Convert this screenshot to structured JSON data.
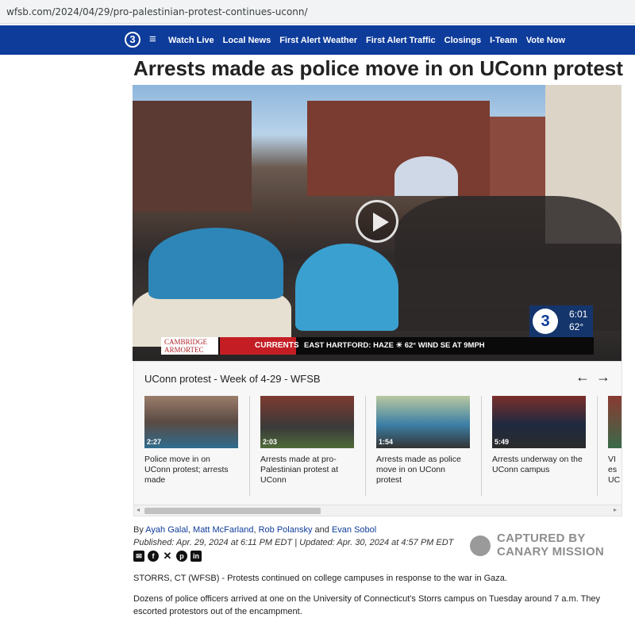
{
  "browser": {
    "url": "wfsb.com/2024/04/29/pro-palestinian-protest-continues-uconn/"
  },
  "nav": {
    "logo": "3",
    "menu_icon": "≡",
    "links": [
      "Watch Live",
      "Local News",
      "First Alert Weather",
      "First Alert Traffic",
      "Closings",
      "I-Team",
      "Vote Now"
    ]
  },
  "article": {
    "headline": "Arrests made as police move in on UConn protest",
    "byline": {
      "prefix": "By",
      "authors": [
        "Ayah Galal",
        "Matt McFarland",
        "Rob Polansky"
      ],
      "and": "and",
      "last_author": "Evan Sobol",
      "comma": ","
    },
    "published": "Published: Apr. 29, 2024 at 6:11 PM EDT",
    "separator": "|",
    "updated": "Updated: Apr. 30, 2024 at 4:57 PM EDT",
    "paragraphs": [
      "STORRS, CT (WFSB) - Protests continued on college campuses in response to the war in Gaza.",
      "Dozens of police officers arrived at one on the University of Connecticut's Storrs campus on Tuesday around 7 a.m. They escorted protestors out of the encampment."
    ]
  },
  "player": {
    "bug_logo": "3",
    "time": "6:01",
    "temp": "62°",
    "sponsor_line1": "CAMBRIDGE",
    "sponsor_line2": "ARMORTEC",
    "currents": "CURRENTS",
    "weather": "EAST HARTFORD:   HAZE   ☀  62°  WIND SE AT 9MPH"
  },
  "playlist": {
    "title": "UConn protest - Week of 4-29 - WFSB",
    "prev": "←",
    "next": "→",
    "items": [
      {
        "caption": "Police move in on UConn protest; arrests made",
        "duration": "2:27"
      },
      {
        "caption": "Arrests made at pro-Palestinian protest at UConn",
        "duration": "2:03"
      },
      {
        "caption": "Arrests made as police move in on UConn protest",
        "duration": "1:54"
      },
      {
        "caption": "Arrests underway on the UConn campus",
        "duration": "5:49"
      },
      {
        "caption": "VI es UC",
        "duration": ""
      }
    ],
    "scroll_left": "◂",
    "scroll_right": "▸"
  },
  "share_icons": [
    "email-icon",
    "facebook-icon",
    "x-icon",
    "pinterest-icon",
    "linkedin-icon"
  ],
  "watermark": {
    "line1": "CAPTURED BY",
    "line2": "CANARY MISSION"
  },
  "colors": {
    "nav": "#0e3c9b",
    "link": "#0e3c9b",
    "currents": "#c41e24"
  }
}
